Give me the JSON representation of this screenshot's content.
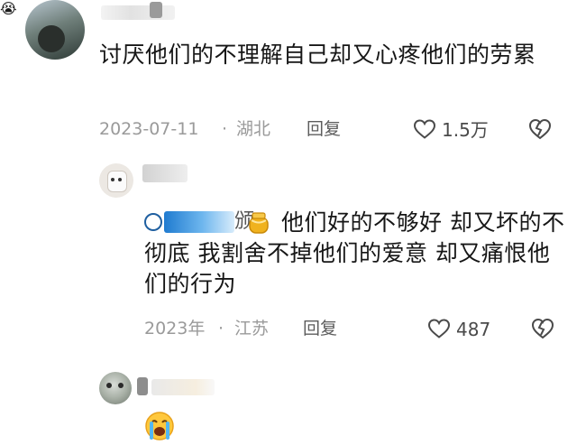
{
  "comment_main": {
    "username": "",
    "text": "讨厌他们的不理解自己却又心疼他们的劳累",
    "date": "2023-07-11",
    "location": "湖北",
    "reply_label": "回复",
    "likes": "1.5万"
  },
  "reply_1": {
    "username": "",
    "mention_suffix": "颁",
    "text": "他们好的不够好 却又坏的不彻底 我割舍不掉他们的爱意 却又痛恨他们的行为",
    "date": "2023年",
    "location": "江苏",
    "reply_label": "回复",
    "likes": "487"
  },
  "reply_2": {
    "username": "",
    "text": "😭"
  },
  "separator": "·",
  "colors": {
    "meta_gray": "#9a9a9a",
    "mention_blue": "#2f8fd8"
  }
}
